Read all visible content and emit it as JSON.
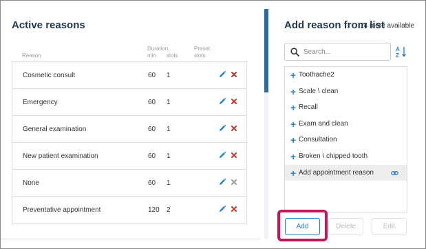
{
  "left": {
    "title": "Active reasons",
    "more_available": "14 more available",
    "headers": {
      "reason": "Reason",
      "duration": "Duration,",
      "min": "min",
      "slots": "slots",
      "preset": "Preset",
      "preset_slots": "slots"
    },
    "rows": [
      {
        "name": "Cosmetic consult",
        "min": "60",
        "slots": "1",
        "delete_active": true
      },
      {
        "name": "Emergency",
        "min": "60",
        "slots": "1",
        "delete_active": true
      },
      {
        "name": "General examination",
        "min": "60",
        "slots": "1",
        "delete_active": true
      },
      {
        "name": "New patient examination",
        "min": "60",
        "slots": "1",
        "delete_active": true
      },
      {
        "name": "None",
        "min": "60",
        "slots": "1",
        "delete_active": false
      },
      {
        "name": "Preventative appointment",
        "min": "120",
        "slots": "2",
        "delete_active": true
      }
    ]
  },
  "right": {
    "title": "Add reason from list",
    "search": {
      "placeholder": "Search...",
      "value": ""
    },
    "sort_icon": "sort-alpha-icon",
    "items": [
      {
        "label": "Toothache2",
        "selected": false,
        "linked": false
      },
      {
        "label": "Scale \\ clean",
        "selected": false,
        "linked": false
      },
      {
        "label": "Recall",
        "selected": false,
        "linked": false
      },
      {
        "label": "Exam and clean",
        "selected": false,
        "linked": false
      },
      {
        "label": "Consultation",
        "selected": false,
        "linked": false
      },
      {
        "label": "Broken \\ chipped tooth",
        "selected": false,
        "linked": false
      },
      {
        "label": "Add appointment reason",
        "selected": true,
        "linked": true
      }
    ],
    "buttons": {
      "add": "Add",
      "delete": "Delete",
      "edit": "Edit"
    }
  },
  "colors": {
    "title": "#1e3a52",
    "accent": "#2d7fc6",
    "delete_red": "#c0392b",
    "highlight": "#c2185b",
    "scroll_thumb": "#2d6a9a"
  }
}
